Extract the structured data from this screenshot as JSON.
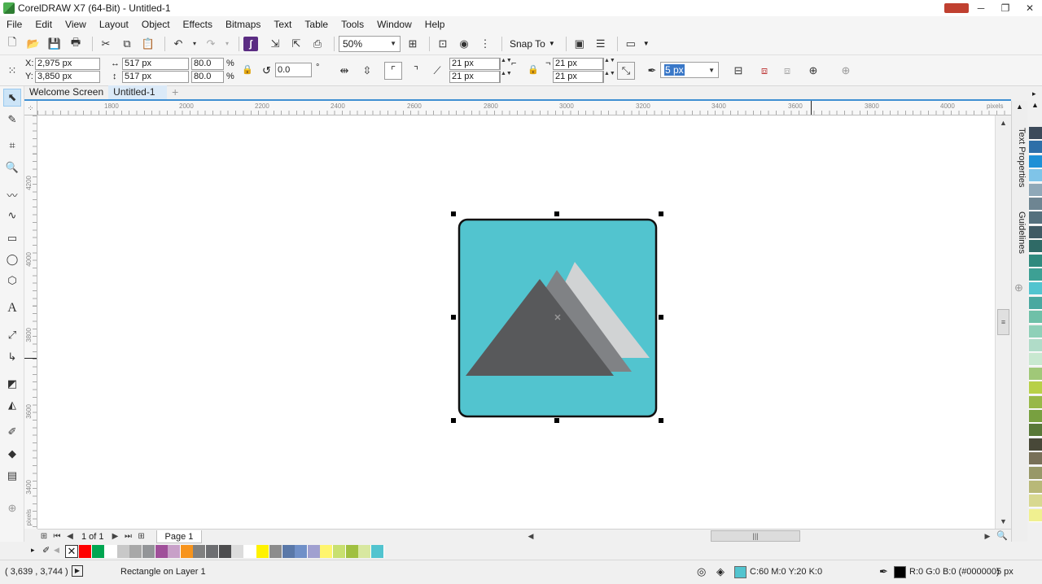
{
  "window": {
    "title": "CorelDRAW X7 (64-Bit) - Untitled-1",
    "minimize": "─",
    "restore": "❐",
    "close": "✕"
  },
  "menu": [
    "File",
    "Edit",
    "View",
    "Layout",
    "Object",
    "Effects",
    "Bitmaps",
    "Text",
    "Table",
    "Tools",
    "Window",
    "Help"
  ],
  "toolbar": {
    "zoom_value": "50%",
    "snap_to": "Snap To"
  },
  "property_bar": {
    "x": "2,975 px",
    "y": "3,850 px",
    "x_label": "X:",
    "y_label": "Y:",
    "width": "517 px",
    "height": "517 px",
    "scale_w": "80.0",
    "scale_h": "80.0",
    "percent": "%",
    "rotation": "0.0",
    "degree": "°",
    "corner_tl": "21 px",
    "corner_bl": "21 px",
    "corner_tr": "21 px",
    "corner_br": "21 px",
    "outline_width": "5 px"
  },
  "tabs": [
    {
      "label": "Welcome Screen",
      "active": false
    },
    {
      "label": "Untitled-1",
      "active": true
    }
  ],
  "hruler": {
    "labels": [
      "1800",
      "2000",
      "2200",
      "2400",
      "2600",
      "2800",
      "3000",
      "3200",
      "3400",
      "3600",
      "3800",
      "4000"
    ],
    "unit": "pixels"
  },
  "vruler": {
    "labels": [
      "4200",
      "4000",
      "3800",
      "3600",
      "3400"
    ],
    "unit": "pixels"
  },
  "canvas_object": {
    "fill_color": "#52c4cf",
    "outline_color": "#111111",
    "mountain_dark": "#58595b",
    "mountain_mid": "#808285",
    "mountain_light": "#d1d3d4"
  },
  "page_nav": {
    "count": "1 of 1",
    "page_tab": "Page 1"
  },
  "dockers": [
    "Text Properties",
    "Guidelines"
  ],
  "right_palette": [
    "#3c4a5a",
    "#2e6fa8",
    "#1e90d6",
    "#7fc4e8",
    "#8fa8b8",
    "#6e8592",
    "#54707d",
    "#3f5a64",
    "#2f6a66",
    "#2f8a7e",
    "#3da094",
    "#52c4cf",
    "#4aa8a0",
    "#6fc0a8",
    "#8fd0b8",
    "#b0dcc8",
    "#c8e8d0",
    "#a0c878",
    "#b8d048",
    "#98b848",
    "#78a040",
    "#587838",
    "#484838",
    "#787058",
    "#989868",
    "#b8b878",
    "#d8d890",
    "#f0f090"
  ],
  "bottom_palette": [
    "#ff0000",
    "#00a651",
    "#ffffff",
    "#c8c8c8",
    "#a8a8a8",
    "#939598",
    "#a0509a",
    "#c8a0c8",
    "#f7941d",
    "#808080",
    "#6d6e71",
    "#4d4d4f",
    "#dcdcdc",
    "#ffffff",
    "#fff200",
    "#8c8c8c",
    "#5a78a8",
    "#7090c8",
    "#a0a0d0",
    "#fff56e",
    "#c8e070",
    "#a0c040",
    "#d8e8a0",
    "#52c4cf"
  ],
  "status": {
    "cursor": "( 3,639 , 3,744 )",
    "object_info": "Rectangle on Layer 1",
    "fill_color": "#52c4cf",
    "fill_info": "C:60 M:0 Y:20 K:0",
    "outline_color": "#000000",
    "outline_info": "R:0 G:0 B:0 (#000000)",
    "outline_width": "5 px"
  }
}
